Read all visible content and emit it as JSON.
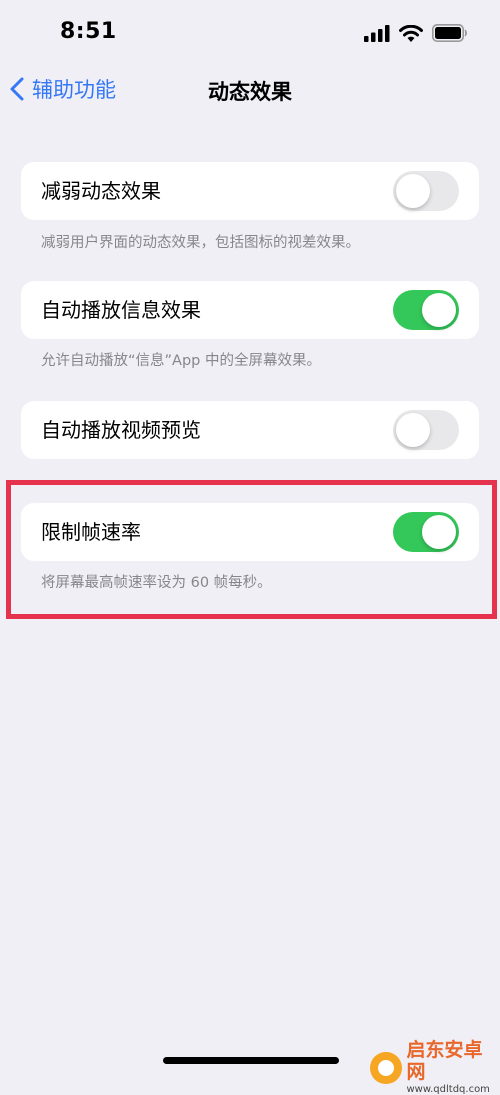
{
  "status_bar": {
    "time": "8:51"
  },
  "nav": {
    "back_label": "辅助功能",
    "title": "动态效果"
  },
  "settings": [
    {
      "label": "减弱动态效果",
      "on": false,
      "footnote": "减弱用户界面的动态效果，包括图标的视差效果。"
    },
    {
      "label": "自动播放信息效果",
      "on": true,
      "footnote": "允许自动播放“信息”App 中的全屏幕效果。"
    },
    {
      "label": "自动播放视频预览",
      "on": false,
      "footnote": ""
    },
    {
      "label": "限制帧速率",
      "on": true,
      "footnote": "将屏幕最高帧速率设为 60 帧每秒。"
    }
  ],
  "colors": {
    "accent": "#3478f6",
    "toggle_on": "#34c759",
    "highlight": "#e5334d"
  },
  "watermark": {
    "name": "启东安卓网",
    "url": "www.qdltdq.com"
  }
}
